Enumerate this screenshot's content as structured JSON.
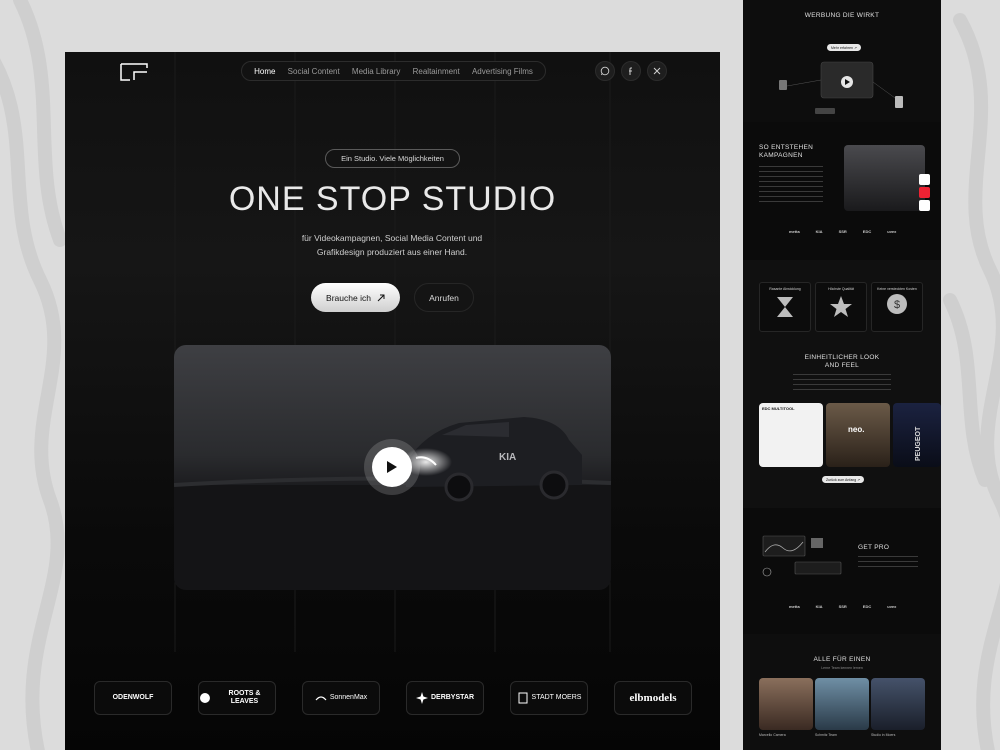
{
  "nav": {
    "items": [
      {
        "label": "Home",
        "active": true
      },
      {
        "label": "Social Content",
        "active": false
      },
      {
        "label": "Media Library",
        "active": false
      },
      {
        "label": "Realtainment",
        "active": false
      },
      {
        "label": "Advertising Films",
        "active": false
      }
    ],
    "socials": [
      "whatsapp-icon",
      "facebook-icon",
      "x-icon"
    ]
  },
  "hero": {
    "tagline": "Ein Studio. Viele Möglichkeiten",
    "title": "ONE STOP STUDIO",
    "subtitle": "für Videokampagnen, Social Media Content und Grafikdesign produziert aus einer Hand.",
    "primary_button": "Brauche ich",
    "secondary_button": "Anrufen"
  },
  "video": {
    "brand": "KIA"
  },
  "client_logos": [
    "ODENWOLF",
    "ROOTS & LEAVES",
    "SonnenMax",
    "DERBYSTAR",
    "STADT MOERS",
    "elbmodels"
  ],
  "preview": {
    "s1": {
      "title": "WERBUNG DIE WIRKT",
      "button": "Mehr erfahren ↗"
    },
    "s2": {
      "title": "SO ENTSTEHEN KAMPAGNEN",
      "logos": [
        "metta",
        "KIA",
        "SSR",
        "EDC",
        "uvex"
      ]
    },
    "s3": {
      "cards": [
        "Rasante Abwicklung",
        "Höchste Qualität",
        "Keine versteckten Kosten"
      ],
      "title": "EINHEITLICHER LOOK AND FEEL",
      "tiles": [
        "EDC MULTITOOL",
        "neo.",
        "PEUGEOT"
      ],
      "button": "Zurück zum Anfang ↗"
    },
    "s4": {
      "title": "GET PRO",
      "logos": [
        "metta",
        "KIA",
        "SSR",
        "EDC",
        "uvex"
      ]
    },
    "s5": {
      "title": "ALLE FÜR EINEN",
      "subtitle": "Lerne Team kennen lernen",
      "members": [
        "Marcello Camera",
        "Schmitz Team",
        "Studio in Moers"
      ]
    }
  },
  "colors": {
    "background": "#dcdcdc",
    "hero_bg": "#101010",
    "accent": "#ffffff"
  }
}
